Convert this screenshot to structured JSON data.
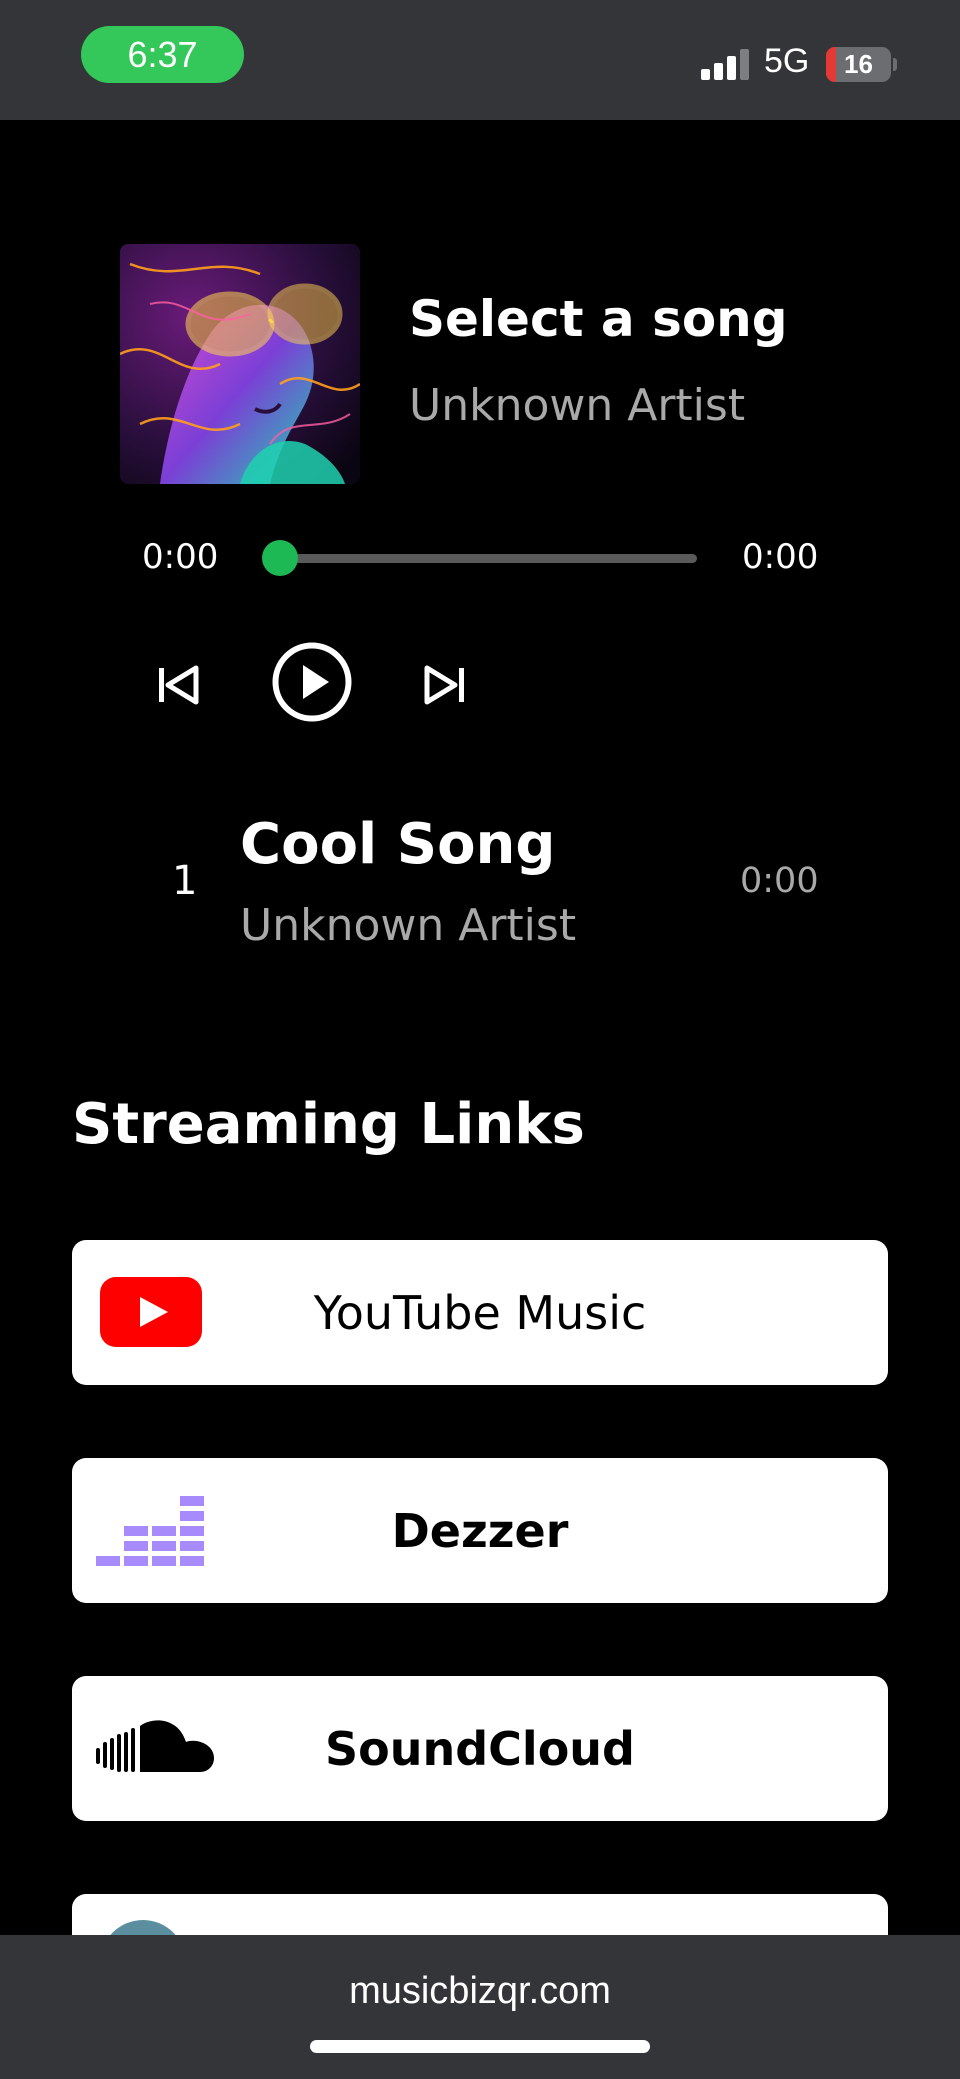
{
  "status_bar": {
    "time": "6:37",
    "network": "5G",
    "battery": "16",
    "battery_level_percent": 16,
    "colors": {
      "time_pill": "#34c759",
      "battery_low": "#e53935"
    }
  },
  "player": {
    "title": "Select a song",
    "artist": "Unknown Artist",
    "current_time": "0:00",
    "total_time": "0:00",
    "progress_percent": 0,
    "accent": "#1db954",
    "icons": [
      "album-art",
      "skip-previous-icon",
      "play-icon",
      "skip-next-icon"
    ]
  },
  "tracks": [
    {
      "number": "1",
      "title": "Cool Song",
      "artist": "Unknown Artist",
      "duration": "0:00"
    }
  ],
  "streaming": {
    "heading": "Streaming Links",
    "links": [
      {
        "label": "YouTube Music",
        "icon": "youtube-icon",
        "color": "#ff0000"
      },
      {
        "label": "Dezzer",
        "icon": "deezer-icon",
        "color": "#a78bfa"
      },
      {
        "label": "SoundCloud",
        "icon": "soundcloud-icon",
        "color": "#000000"
      },
      {
        "label": "",
        "icon": "partial-avatar-icon",
        "color": "#5b8fa0"
      }
    ]
  },
  "browser": {
    "url": "musicbizqr.com"
  }
}
